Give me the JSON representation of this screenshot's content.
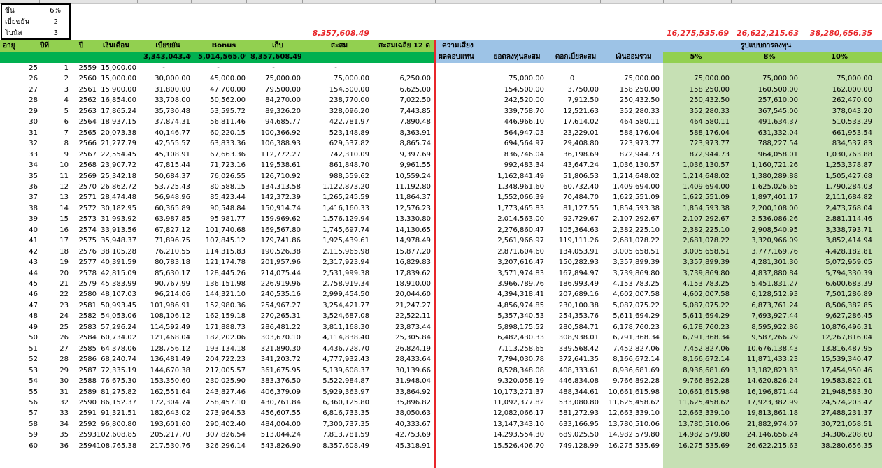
{
  "params": [
    {
      "label": "ขึ้น",
      "value": "6%"
    },
    {
      "label": "เบี้ยขยัน",
      "value": "2"
    },
    {
      "label": "โบนัส",
      "value": "3"
    }
  ],
  "top_red_totals": {
    "collected": "8,357,608.49",
    "r5": "16,275,535.69",
    "r8": "26,622,215.63",
    "r10": "38,280,656.35"
  },
  "headers": {
    "age": "อายุ",
    "year_no": "ปีที่",
    "year": "ปี",
    "salary": "เงินเดือน",
    "diligence": "เบี้ยขยัน",
    "bonus": "Bonus",
    "save": "เก็บ",
    "accum": "สะสม",
    "avg12": "สะสมเฉลี่ย 12 ด",
    "risk": "ความเสี่ยง",
    "return": "ผลตอบแทน",
    "invest_total": "ยอดลงทุนสะสม",
    "interest_total": "ดอกเบี้ยสะสม",
    "savings_total": "เงินออมรวม",
    "invest_type": "รูปแบบการลงทุน",
    "r5": "5%",
    "r8": "8%",
    "r10": "10%"
  },
  "totals": {
    "diligence": "3,343,043.40",
    "bonus": "5,014,565.09",
    "save": "8,357,608.49"
  },
  "rows": [
    [
      "25",
      "1",
      "2559",
      "15,000.00",
      "-",
      "-",
      "-",
      "-",
      "",
      "",
      "",
      "",
      "",
      "",
      ""
    ],
    [
      "26",
      "2",
      "2560",
      "15,000.00",
      "30,000.00",
      "45,000.00",
      "75,000.00",
      "75,000.00",
      "6,250.00",
      "75,000.00",
      "0",
      "75,000.00",
      "75,000.00",
      "75,000.00",
      "75,000.00"
    ],
    [
      "27",
      "3",
      "2561",
      "15,900.00",
      "31,800.00",
      "47,700.00",
      "79,500.00",
      "154,500.00",
      "6,625.00",
      "154,500.00",
      "3,750.00",
      "158,250.00",
      "158,250.00",
      "160,500.00",
      "162,000.00"
    ],
    [
      "28",
      "4",
      "2562",
      "16,854.00",
      "33,708.00",
      "50,562.00",
      "84,270.00",
      "238,770.00",
      "7,022.50",
      "242,520.00",
      "7,912.50",
      "250,432.50",
      "250,432.50",
      "257,610.00",
      "262,470.00"
    ],
    [
      "29",
      "5",
      "2563",
      "17,865.24",
      "35,730.48",
      "53,595.72",
      "89,326.20",
      "328,096.20",
      "7,443.85",
      "339,758.70",
      "12,521.63",
      "352,280.33",
      "352,280.33",
      "367,545.00",
      "378,043.20"
    ],
    [
      "30",
      "6",
      "2564",
      "18,937.15",
      "37,874.31",
      "56,811.46",
      "94,685.77",
      "422,781.97",
      "7,890.48",
      "446,966.10",
      "17,614.02",
      "464,580.11",
      "464,580.11",
      "491,634.37",
      "510,533.29"
    ],
    [
      "31",
      "7",
      "2565",
      "20,073.38",
      "40,146.77",
      "60,220.15",
      "100,366.92",
      "523,148.89",
      "8,363.91",
      "564,947.03",
      "23,229.01",
      "588,176.04",
      "588,176.04",
      "631,332.04",
      "661,953.54"
    ],
    [
      "32",
      "8",
      "2566",
      "21,277.79",
      "42,555.57",
      "63,833.36",
      "106,388.93",
      "629,537.82",
      "8,865.74",
      "694,564.97",
      "29,408.80",
      "723,973.77",
      "723,973.77",
      "788,227.54",
      "834,537.83"
    ],
    [
      "33",
      "9",
      "2567",
      "22,554.45",
      "45,108.91",
      "67,663.36",
      "112,772.27",
      "742,310.09",
      "9,397.69",
      "836,746.04",
      "36,198.69",
      "872,944.73",
      "872,944.73",
      "964,058.01",
      "1,030,763.88"
    ],
    [
      "34",
      "10",
      "2568",
      "23,907.72",
      "47,815.44",
      "71,723.16",
      "119,538.61",
      "861,848.70",
      "9,961.55",
      "992,483.34",
      "43,647.24",
      "1,036,130.57",
      "1,036,130.57",
      "1,160,721.26",
      "1,253,378.87"
    ],
    [
      "35",
      "11",
      "2569",
      "25,342.18",
      "50,684.37",
      "76,026.55",
      "126,710.92",
      "988,559.62",
      "10,559.24",
      "1,162,841.49",
      "51,806.53",
      "1,214,648.02",
      "1,214,648.02",
      "1,380,289.88",
      "1,505,427.68"
    ],
    [
      "36",
      "12",
      "2570",
      "26,862.72",
      "53,725.43",
      "80,588.15",
      "134,313.58",
      "1,122,873.20",
      "11,192.80",
      "1,348,961.60",
      "60,732.40",
      "1,409,694.00",
      "1,409,694.00",
      "1,625,026.65",
      "1,790,284.03"
    ],
    [
      "37",
      "13",
      "2571",
      "28,474.48",
      "56,948.96",
      "85,423.44",
      "142,372.39",
      "1,265,245.59",
      "11,864.37",
      "1,552,066.39",
      "70,484.70",
      "1,622,551.09",
      "1,622,551.09",
      "1,897,401.17",
      "2,111,684.82"
    ],
    [
      "38",
      "14",
      "2572",
      "30,182.95",
      "60,365.89",
      "90,548.84",
      "150,914.74",
      "1,416,160.33",
      "12,576.23",
      "1,773,465.83",
      "81,127.55",
      "1,854,593.38",
      "1,854,593.38",
      "2,200,108.00",
      "2,473,768.04"
    ],
    [
      "39",
      "15",
      "2573",
      "31,993.92",
      "63,987.85",
      "95,981.77",
      "159,969.62",
      "1,576,129.94",
      "13,330.80",
      "2,014,563.00",
      "92,729.67",
      "2,107,292.67",
      "2,107,292.67",
      "2,536,086.26",
      "2,881,114.46"
    ],
    [
      "40",
      "16",
      "2574",
      "33,913.56",
      "67,827.12",
      "101,740.68",
      "169,567.80",
      "1,745,697.74",
      "14,130.65",
      "2,276,860.47",
      "105,364.63",
      "2,382,225.10",
      "2,382,225.10",
      "2,908,540.95",
      "3,338,793.71"
    ],
    [
      "41",
      "17",
      "2575",
      "35,948.37",
      "71,896.75",
      "107,845.12",
      "179,741.86",
      "1,925,439.61",
      "14,978.49",
      "2,561,966.97",
      "119,111.26",
      "2,681,078.22",
      "2,681,078.22",
      "3,320,966.09",
      "3,852,414.94"
    ],
    [
      "42",
      "18",
      "2576",
      "38,105.28",
      "76,210.55",
      "114,315.83",
      "190,526.38",
      "2,115,965.98",
      "15,877.20",
      "2,871,604.60",
      "134,053.91",
      "3,005,658.51",
      "3,005,658.51",
      "3,777,169.76",
      "4,428,182.81"
    ],
    [
      "43",
      "19",
      "2577",
      "40,391.59",
      "80,783.18",
      "121,174.78",
      "201,957.96",
      "2,317,923.94",
      "16,829.83",
      "3,207,616.47",
      "150,282.93",
      "3,357,899.39",
      "3,357,899.39",
      "4,281,301.30",
      "5,072,959.05"
    ],
    [
      "44",
      "20",
      "2578",
      "42,815.09",
      "85,630.17",
      "128,445.26",
      "214,075.44",
      "2,531,999.38",
      "17,839.62",
      "3,571,974.83",
      "167,894.97",
      "3,739,869.80",
      "3,739,869.80",
      "4,837,880.84",
      "5,794,330.39"
    ],
    [
      "45",
      "21",
      "2579",
      "45,383.99",
      "90,767.99",
      "136,151.98",
      "226,919.96",
      "2,758,919.34",
      "18,910.00",
      "3,966,789.76",
      "186,993.49",
      "4,153,783.25",
      "4,153,783.25",
      "5,451,831.27",
      "6,600,683.39"
    ],
    [
      "46",
      "22",
      "2580",
      "48,107.03",
      "96,214.06",
      "144,321.10",
      "240,535.16",
      "2,999,454.50",
      "20,044.60",
      "4,394,318.41",
      "207,689.16",
      "4,602,007.58",
      "4,602,007.58",
      "6,128,512.93",
      "7,501,286.89"
    ],
    [
      "47",
      "23",
      "2581",
      "50,993.45",
      "101,986.91",
      "152,980.36",
      "254,967.27",
      "3,254,421.77",
      "21,247.27",
      "4,856,974.85",
      "230,100.38",
      "5,087,075.22",
      "5,087,075.22",
      "6,873,761.24",
      "8,506,382.85"
    ],
    [
      "48",
      "24",
      "2582",
      "54,053.06",
      "108,106.12",
      "162,159.18",
      "270,265.31",
      "3,524,687.08",
      "22,522.11",
      "5,357,340.53",
      "254,353.76",
      "5,611,694.29",
      "5,611,694.29",
      "7,693,927.44",
      "9,627,286.45"
    ],
    [
      "49",
      "25",
      "2583",
      "57,296.24",
      "114,592.49",
      "171,888.73",
      "286,481.22",
      "3,811,168.30",
      "23,873.44",
      "5,898,175.52",
      "280,584.71",
      "6,178,760.23",
      "6,178,760.23",
      "8,595,922.86",
      "10,876,496.31"
    ],
    [
      "50",
      "26",
      "2584",
      "60,734.02",
      "121,468.04",
      "182,202.06",
      "303,670.10",
      "4,114,838.40",
      "25,305.84",
      "6,482,430.33",
      "308,938.01",
      "6,791,368.34",
      "6,791,368.34",
      "9,587,266.79",
      "12,267,816.04"
    ],
    [
      "51",
      "27",
      "2585",
      "64,378.06",
      "128,756.12",
      "193,134.18",
      "321,890.30",
      "4,436,728.70",
      "26,824.19",
      "7,113,258.65",
      "339,568.42",
      "7,452,827.06",
      "7,452,827.06",
      "10,676,138.43",
      "13,816,487.95"
    ],
    [
      "52",
      "28",
      "2586",
      "68,240.74",
      "136,481.49",
      "204,722.23",
      "341,203.72",
      "4,777,932.43",
      "28,433.64",
      "7,794,030.78",
      "372,641.35",
      "8,166,672.14",
      "8,166,672.14",
      "11,871,433.23",
      "15,539,340.47"
    ],
    [
      "53",
      "29",
      "2587",
      "72,335.19",
      "144,670.38",
      "217,005.57",
      "361,675.95",
      "5,139,608.37",
      "30,139.66",
      "8,528,348.08",
      "408,333.61",
      "8,936,681.69",
      "8,936,681.69",
      "13,182,823.83",
      "17,454,950.46"
    ],
    [
      "54",
      "30",
      "2588",
      "76,675.30",
      "153,350.60",
      "230,025.90",
      "383,376.50",
      "5,522,984.87",
      "31,948.04",
      "9,320,058.19",
      "446,834.08",
      "9,766,892.28",
      "9,766,892.28",
      "14,620,826.24",
      "19,583,822.01"
    ],
    [
      "55",
      "31",
      "2589",
      "81,275.82",
      "162,551.64",
      "243,827.46",
      "406,379.09",
      "5,929,363.97",
      "33,864.92",
      "10,173,271.37",
      "488,344.61",
      "10,661,615.98",
      "10,661,615.98",
      "16,196,871.44",
      "21,948,583.30"
    ],
    [
      "56",
      "32",
      "2590",
      "86,152.37",
      "172,304.74",
      "258,457.10",
      "430,761.84",
      "6,360,125.80",
      "35,896.82",
      "11,092,377.82",
      "533,080.80",
      "11,625,458.62",
      "11,625,458.62",
      "17,923,382.99",
      "24,574,203.47"
    ],
    [
      "57",
      "33",
      "2591",
      "91,321.51",
      "182,643.02",
      "273,964.53",
      "456,607.55",
      "6,816,733.35",
      "38,050.63",
      "12,082,066.17",
      "581,272.93",
      "12,663,339.10",
      "12,663,339.10",
      "19,813,861.18",
      "27,488,231.37"
    ],
    [
      "58",
      "34",
      "2592",
      "96,800.80",
      "193,601.60",
      "290,402.40",
      "484,004.00",
      "7,300,737.35",
      "40,333.67",
      "13,147,343.10",
      "633,166.95",
      "13,780,510.06",
      "13,780,510.06",
      "21,882,974.07",
      "30,721,058.51"
    ],
    [
      "59",
      "35",
      "2593",
      "102,608.85",
      "205,217.70",
      "307,826.54",
      "513,044.24",
      "7,813,781.59",
      "42,753.69",
      "14,293,554.30",
      "689,025.50",
      "14,982,579.80",
      "14,982,579.80",
      "24,146,656.24",
      "34,306,208.60"
    ],
    [
      "60",
      "36",
      "2594",
      "108,765.38",
      "217,530.76",
      "326,296.14",
      "543,826.90",
      "8,357,608.49",
      "45,318.91",
      "15,526,406.70",
      "749,128.99",
      "16,275,535.69",
      "16,275,535.69",
      "26,622,215.63",
      "38,280,656.35"
    ]
  ]
}
